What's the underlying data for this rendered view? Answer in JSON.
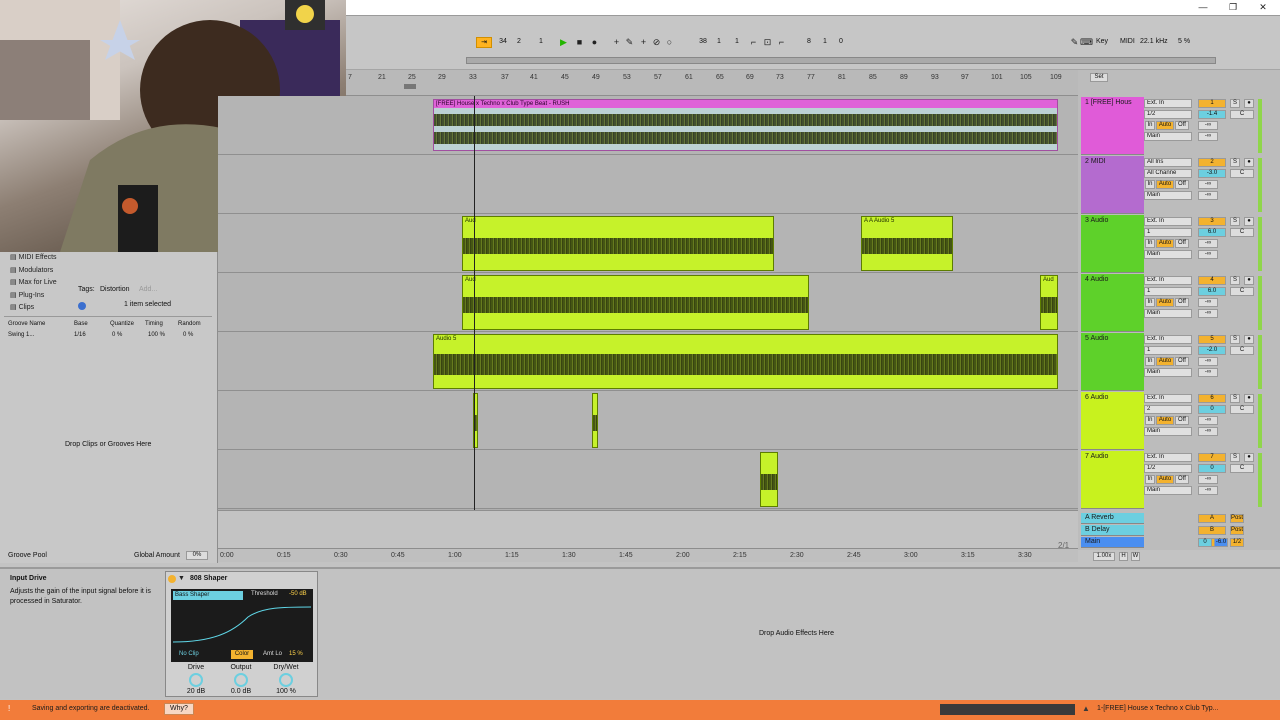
{
  "window": {
    "minimize_glyph": "—",
    "restore_glyph": "❐",
    "close_glyph": "✕"
  },
  "transport": {
    "follow_glyph": "⇥",
    "position": [
      "34",
      "2",
      "1"
    ],
    "loop_start": [
      "38",
      "1",
      "1"
    ],
    "loop_length": [
      "8",
      "1",
      "0"
    ],
    "key_label": "Key",
    "midi_label": "MIDI",
    "sample_rate": "22.1 kHz",
    "cpu": "5 %"
  },
  "ruler": {
    "bars": [
      "7",
      "21",
      "25",
      "29",
      "33",
      "37",
      "41",
      "45",
      "49",
      "53",
      "57",
      "61",
      "65",
      "69",
      "73",
      "77",
      "81",
      "85",
      "89",
      "93",
      "97",
      "101",
      "105",
      "109"
    ],
    "set_label": "Set"
  },
  "tracks": [
    {
      "num": "1",
      "name": "1 [FREE] Hous",
      "input": "Ext. In",
      "channel": "1/2",
      "monitor": [
        "In",
        "Auto",
        "Off"
      ],
      "out": "Main",
      "vol": "-1.4",
      "pan": "C",
      "color": "#e05bd8"
    },
    {
      "num": "2",
      "name": "2 MIDI",
      "input": "All Ins",
      "channel": "All Channe",
      "monitor": [
        "In",
        "Auto",
        "Off"
      ],
      "out": "Main",
      "vol": "-3.0",
      "pan": "C",
      "color": "#b46bcf"
    },
    {
      "num": "3",
      "name": "3 Audio",
      "input": "Ext. In",
      "channel": "1",
      "monitor": [
        "In",
        "Auto",
        "Off"
      ],
      "out": "Main",
      "vol": "6.0",
      "pan": "C",
      "color": "#5ed12a"
    },
    {
      "num": "4",
      "name": "4 Audio",
      "input": "Ext. In",
      "channel": "1",
      "monitor": [
        "In",
        "Auto",
        "Off"
      ],
      "out": "Main",
      "vol": "6.0",
      "pan": "C",
      "color": "#5ed12a"
    },
    {
      "num": "5",
      "name": "5 Audio",
      "input": "Ext. In",
      "channel": "1",
      "monitor": [
        "In",
        "Auto",
        "Off"
      ],
      "out": "Main",
      "vol": "-2.0",
      "pan": "C",
      "color": "#5ed12a"
    },
    {
      "num": "6",
      "name": "6 Audio",
      "input": "Ext. In",
      "channel": "2",
      "monitor": [
        "In",
        "Auto",
        "Off"
      ],
      "out": "Main",
      "vol": "0",
      "pan": "C",
      "color": "#c8f21e"
    },
    {
      "num": "7",
      "name": "7 Audio",
      "input": "Ext. In",
      "channel": "1/2",
      "monitor": [
        "In",
        "Auto",
        "Off"
      ],
      "out": "Main",
      "vol": "0",
      "pan": "C",
      "color": "#c8f21e"
    }
  ],
  "returns": [
    {
      "name": "A Reverb",
      "letter": "A",
      "post": "Post"
    },
    {
      "name": "B Delay",
      "letter": "B",
      "post": "Post"
    },
    {
      "name": "Main",
      "letter": "",
      "post": "1/2"
    }
  ],
  "main_vol": "0",
  "main_vol2": "-6.0",
  "inf": "-∞",
  "minus_inf_short": "-∞",
  "arrangement": {
    "clip1_name": "[FREE] House x Techno x Club Type Beat - RUSH",
    "clip_audio": "Aud",
    "clip_audio_full": "Audio",
    "clip_audio5": "Audio 5",
    "clip_audio_s": "A A Audio 5",
    "page": "2/1"
  },
  "time_marks": [
    "0:00",
    "0:15",
    "0:30",
    "0:45",
    "1:00",
    "1:15",
    "1:30",
    "1:45",
    "2:00",
    "2:15",
    "2:30",
    "2:45",
    "3:00",
    "3:15",
    "3:30"
  ],
  "zoom": "1.00x",
  "hw": [
    "H",
    "W"
  ],
  "browser": {
    "items": [
      "MIDI Effects",
      "Modulators",
      "Max for Live",
      "Plug-Ins",
      "Clips"
    ],
    "tags_label": "Tags:",
    "tag": "Distortion",
    "add": "Add...",
    "selected": "1 item selected",
    "groove_cols": [
      "Groove Name",
      "Base",
      "Quantize",
      "Timing",
      "Random"
    ],
    "groove_row": [
      "Swing 1...",
      "1/16",
      "0 %",
      "100 %",
      "0 %"
    ],
    "drop_text": "Drop Clips or Grooves Here",
    "groove_pool": "Groove Pool",
    "global_amount_label": "Global Amount",
    "global_amount": "0%"
  },
  "info": {
    "title": "Input Drive",
    "text": "Adjusts the gain of the input signal before it is processed in Saturator."
  },
  "device": {
    "name": "808 Shaper",
    "shaper": "Bass Shaper",
    "threshold_label": "Threshold",
    "threshold": "-50 dB",
    "no_clip": "No Clip",
    "color": "Color",
    "amt_label": "Amt Lo",
    "amt": "15 %",
    "knobs": [
      {
        "label": "Drive",
        "value": "20 dB"
      },
      {
        "label": "Output",
        "value": "0.0 dB"
      },
      {
        "label": "Dry/Wet",
        "value": "100 %"
      }
    ],
    "drop_effects": "Drop Audio Effects Here"
  },
  "status": {
    "message": "Saving and exporting are deactivated.",
    "why": "Why?",
    "clip_label": "1-[FREE] House x Techno x Club Typ..."
  }
}
